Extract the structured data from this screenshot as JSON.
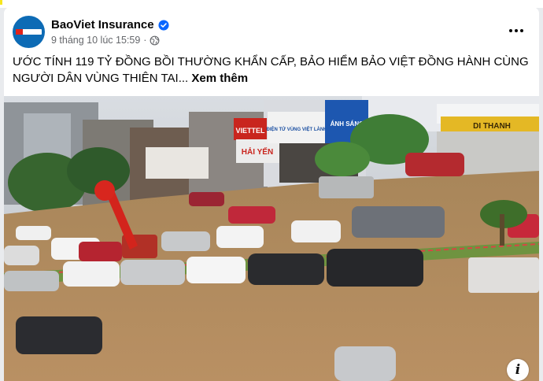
{
  "post": {
    "author": "BaoViet Insurance",
    "timestamp": "9 tháng 10 lúc 15:59",
    "separator": "·",
    "text": "ƯỚC TÍNH 119 TỶ ĐỒNG BỒI THƯỜNG KHẨN CẤP, BẢO HIỂM BẢO VIỆT ĐỒNG HÀNH CÙNG NGƯỜI DÂN VÙNG THIÊN TAI...",
    "see_more_label": "Xem thêm",
    "info_label": "i"
  },
  "photo": {
    "signs": [
      "VIETTEL",
      "HẢI YẾN",
      "ĐIỆN TỬ VÙNG VIỆT LÀNH",
      "ÁNH SÁNG",
      "DI THANH"
    ]
  },
  "icons": {
    "verified": "verified-badge-icon",
    "audience": "globe-icon",
    "more": "more-options-icon",
    "info": "info-icon"
  },
  "colors": {
    "accent": "#0866ff",
    "brand_blue": "#0d6bb5",
    "text_primary": "#050505",
    "text_secondary": "#65676b",
    "flood_water": "#b08a5a"
  }
}
